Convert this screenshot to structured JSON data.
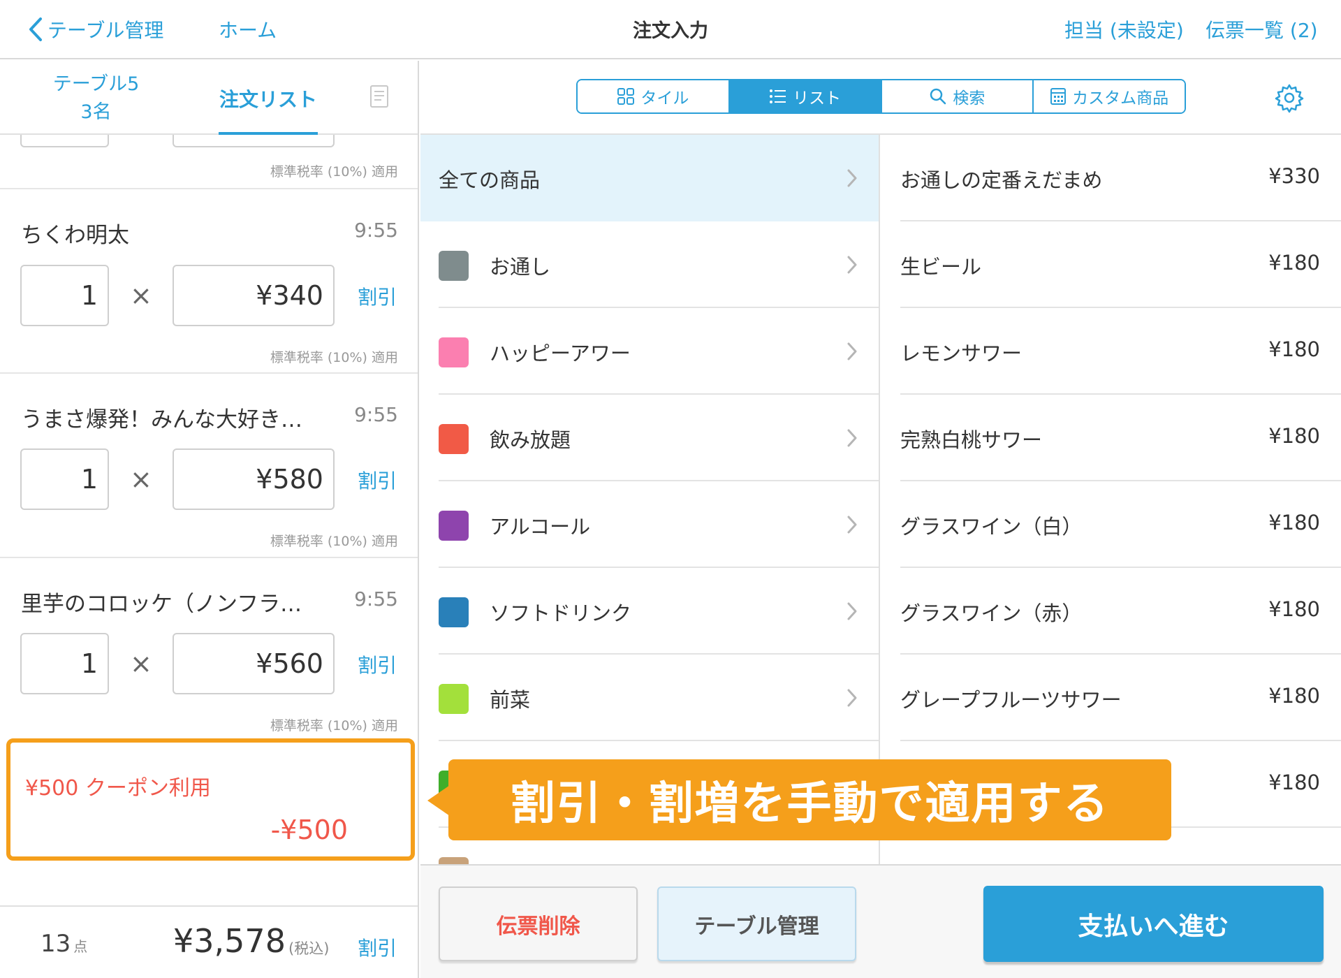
{
  "nav": {
    "back_label": "テーブル管理",
    "home_label": "ホーム",
    "title": "注文入力",
    "staff_label": "担当 (未設定)",
    "slips_label": "伝票一覧 (2)"
  },
  "left": {
    "tab_table_line1": "テーブル5",
    "tab_table_line2": "3名",
    "tab_order": "注文リスト",
    "tax_note": "標準税率 (10%) 適用",
    "items": [
      {
        "name": "ちくわ明太",
        "time": "9:55",
        "qty": "1",
        "price": "¥340",
        "discount": "割引",
        "tax": "標準税率 (10%) 適用"
      },
      {
        "name": "うまさ爆発！みんな大好き…",
        "time": "9:55",
        "qty": "1",
        "price": "¥580",
        "discount": "割引",
        "tax": "標準税率 (10%) 適用"
      },
      {
        "name": "里芋のコロッケ（ノンフラ…",
        "time": "9:55",
        "qty": "1",
        "price": "¥560",
        "discount": "割引",
        "tax": "標準税率 (10%) 適用"
      }
    ],
    "times_symbol": "×",
    "coupon": {
      "name": "¥500 クーポン利用",
      "value": "-¥500"
    },
    "footer": {
      "count": "13",
      "count_unit": "点",
      "total": "¥3,578",
      "tax_included": "(税込)",
      "discount": "割引"
    }
  },
  "view_switch": {
    "tile": "タイル",
    "list": "リスト",
    "search": "検索",
    "custom": "カスタム商品",
    "active": "list"
  },
  "categories": [
    {
      "name": "全ての商品",
      "color": null
    },
    {
      "name": "お通し",
      "color": "#7f8c8d"
    },
    {
      "name": "ハッピーアワー",
      "color": "#fb7fb0"
    },
    {
      "name": "飲み放題",
      "color": "#f15a46"
    },
    {
      "name": "アルコール",
      "color": "#8e44ad"
    },
    {
      "name": "ソフトドリンク",
      "color": "#2980b9"
    },
    {
      "name": "前菜",
      "color": "#a3e03b"
    }
  ],
  "products": [
    {
      "name": "お通しの定番えだまめ",
      "price": "¥330"
    },
    {
      "name": "生ビール",
      "price": "¥180"
    },
    {
      "name": "レモンサワー",
      "price": "¥180"
    },
    {
      "name": "完熟白桃サワー",
      "price": "¥180"
    },
    {
      "name": "グラスワイン（白）",
      "price": "¥180"
    },
    {
      "name": "グラスワイン（赤）",
      "price": "¥180"
    },
    {
      "name": "グレープフルーツサワー",
      "price": "¥180"
    },
    {
      "name": "",
      "price": "¥180"
    }
  ],
  "bottom": {
    "delete_label": "伝票削除",
    "table_label": "テーブル管理",
    "pay_label": "支払いへ進む"
  },
  "callout": {
    "text": "割引・割増を手動で適用する"
  },
  "colors": {
    "accent": "#2a9fd8",
    "callout": "#f59f1b",
    "danger": "#f0574a"
  }
}
